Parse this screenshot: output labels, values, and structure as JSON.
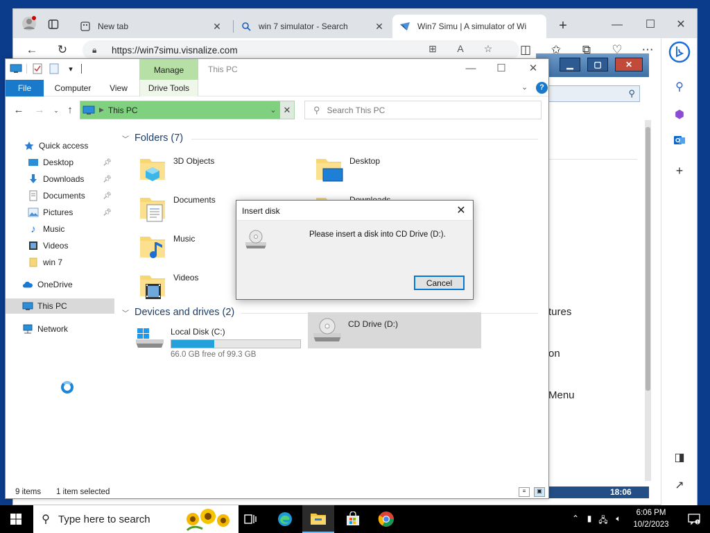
{
  "browser": {
    "tabs": [
      {
        "label": "New tab",
        "icon": "new-tab-icon"
      },
      {
        "label": "win 7 simulator - Search",
        "icon": "search-icon"
      },
      {
        "label": "Win7 Simu | A simulator of Wi",
        "icon": "win7simu-favicon"
      }
    ],
    "new_tab_symbol": "+",
    "url": "https://win7simu.visnalize.com"
  },
  "win7": {
    "text_1": "tures",
    "text_2": "on",
    "text_3": "Menu",
    "clock": "18:06",
    "date": "10/2/2023"
  },
  "explorer": {
    "title": "This PC",
    "manage_tab": "Manage",
    "ribbon_tabs": [
      "File",
      "Computer",
      "View",
      "Drive Tools"
    ],
    "address": "This PC",
    "search_placeholder": "Search This PC",
    "nav": [
      {
        "label": "Quick access"
      },
      {
        "label": "Desktop",
        "pinned": true
      },
      {
        "label": "Downloads",
        "pinned": true
      },
      {
        "label": "Documents",
        "pinned": true
      },
      {
        "label": "Pictures",
        "pinned": true
      },
      {
        "label": "Music"
      },
      {
        "label": "Videos"
      },
      {
        "label": "win 7"
      },
      {
        "label": "OneDrive"
      },
      {
        "label": "This PC"
      },
      {
        "label": "Network"
      }
    ],
    "folders_header": "Folders (7)",
    "folders": [
      "3D Objects",
      "Desktop",
      "Documents",
      "Downloads",
      "Music",
      "Videos"
    ],
    "drives_header": "Devices and drives (2)",
    "drives": [
      {
        "name": "Local Disk (C:)",
        "free": "66.0 GB free of 99.3 GB",
        "used_fraction": 0.335
      },
      {
        "name": "CD Drive (D:)"
      }
    ],
    "status_items": "9 items",
    "status_selected": "1 item selected"
  },
  "dialog": {
    "title": "Insert disk",
    "message": "Please insert a disk into CD Drive (D:).",
    "cancel": "Cancel"
  },
  "taskbar": {
    "search_placeholder": "Type here to search",
    "time": "6:06 PM",
    "date": "10/2/2023"
  },
  "colors": {
    "accent": "#0078d7",
    "file_tab": "#1979ca",
    "manage_tab": "#b6e0a5",
    "address_highlight": "#7fd07f",
    "progress": "#26a0da"
  }
}
